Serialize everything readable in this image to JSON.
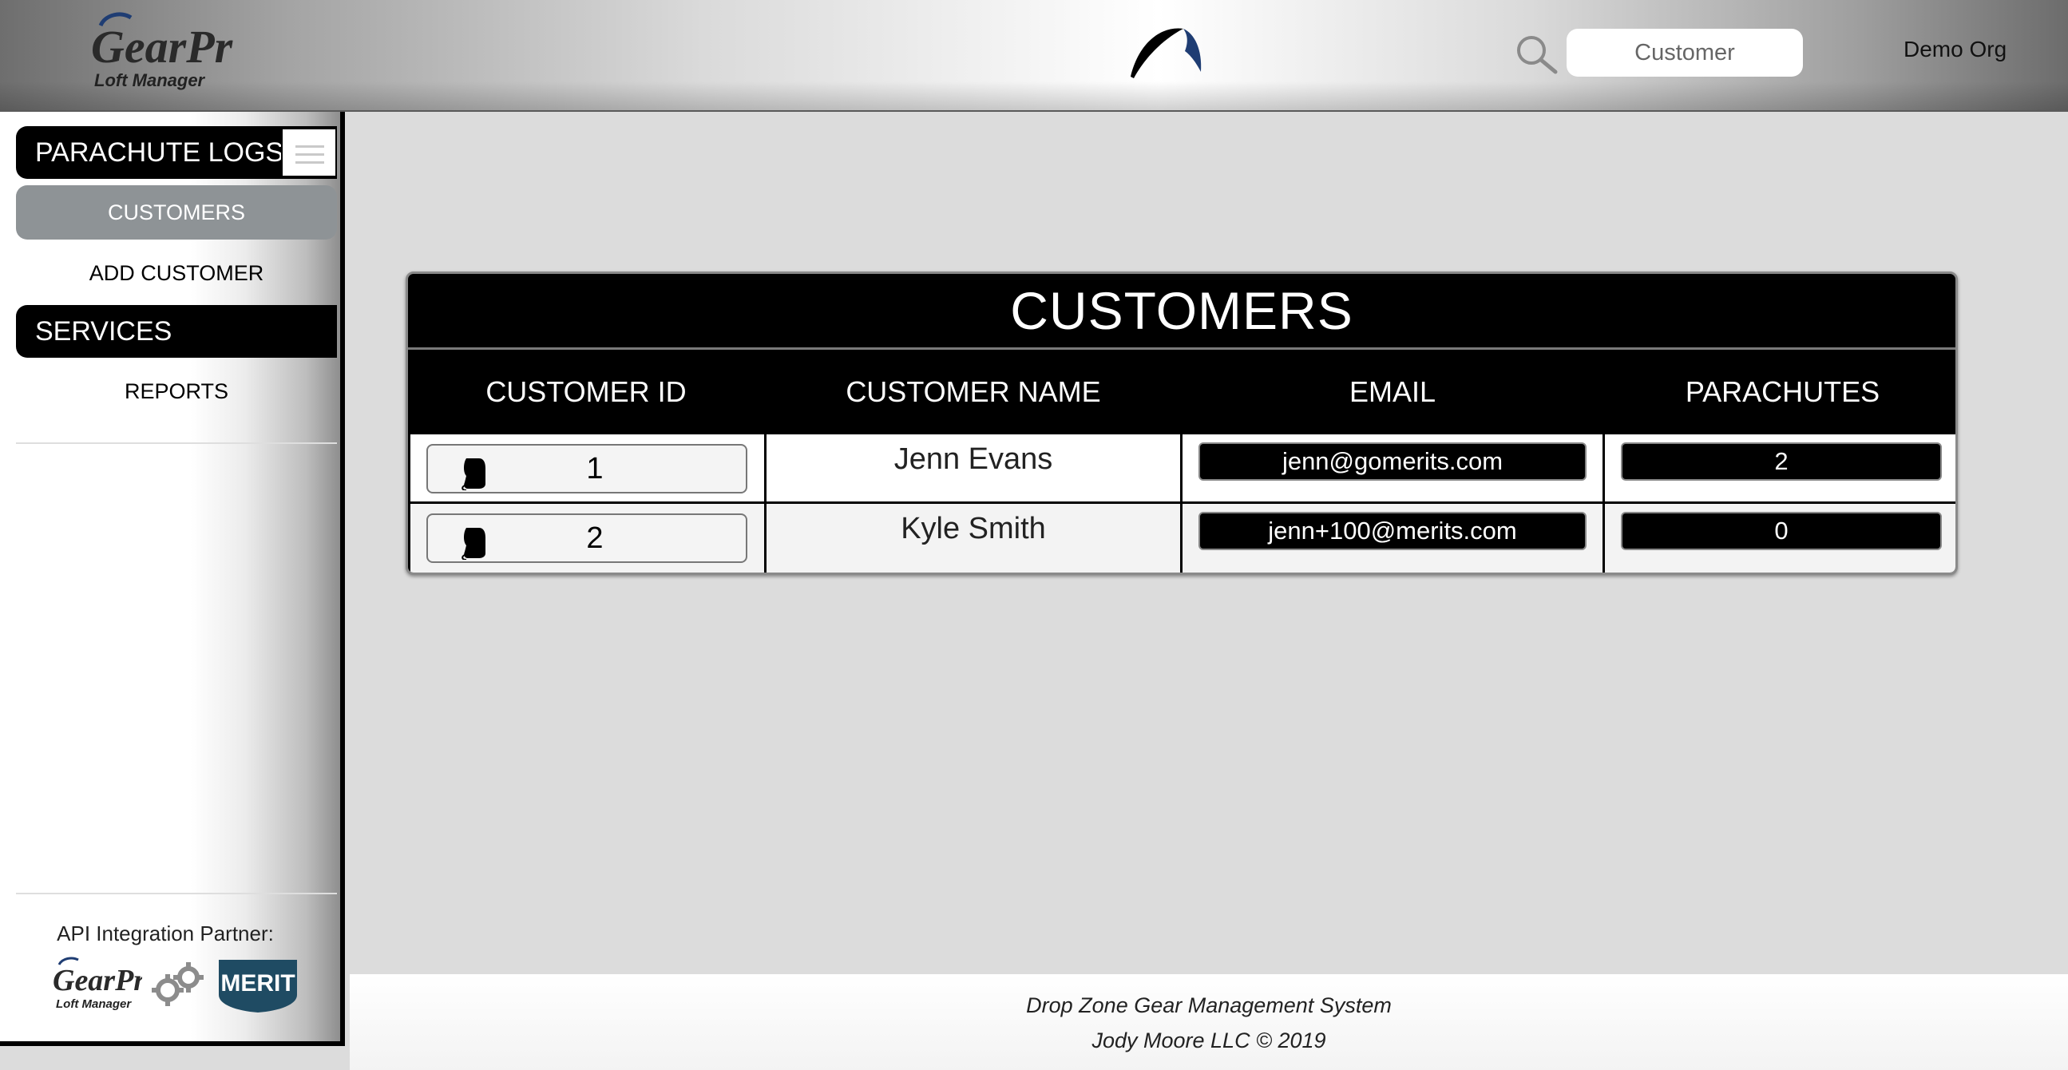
{
  "header": {
    "logo": {
      "word": "GearPro",
      "subtitle": "Loft Manager"
    },
    "search": {
      "placeholder": "Customer"
    },
    "org_name": "Demo Org",
    "icons": {
      "search": "search-icon",
      "canopy": "parachute-canopy-icon"
    }
  },
  "sidebar": {
    "sections": [
      {
        "title": "PARACHUTE LOGS",
        "items": [
          {
            "label": "CUSTOMERS",
            "active": true
          },
          {
            "label": "ADD CUSTOMER",
            "active": false
          }
        ]
      },
      {
        "title": "SERVICES",
        "items": [
          {
            "label": "REPORTS",
            "active": false
          }
        ]
      }
    ],
    "partner_label": "API Integration Partner:",
    "partner_logos": {
      "gearpro_word": "GearPro",
      "gearpro_subtitle": "Loft Manager",
      "merit_word": "MERIT"
    },
    "colors": {
      "active_item": "#8e9396",
      "section_header": "#000000"
    }
  },
  "table": {
    "title": "CUSTOMERS",
    "columns": [
      "CUSTOMER ID",
      "CUSTOMER NAME",
      "EMAIL",
      "PARACHUTES"
    ],
    "rows": [
      {
        "id": "1",
        "name": "Jenn Evans",
        "email": "jenn@gomerits.com",
        "parachutes": "2"
      },
      {
        "id": "2",
        "name": "Kyle Smith",
        "email": "jenn+100@merits.com",
        "parachutes": "0"
      }
    ],
    "row_icon": "parachute-rig-icon"
  },
  "footer": {
    "line1": "Drop Zone Gear Management System",
    "line2": "Jody Moore LLC © 2019"
  },
  "colors": {
    "background": "#dcdcdc",
    "table_header": "#000000",
    "canopy_blue": "#1f3d73"
  }
}
